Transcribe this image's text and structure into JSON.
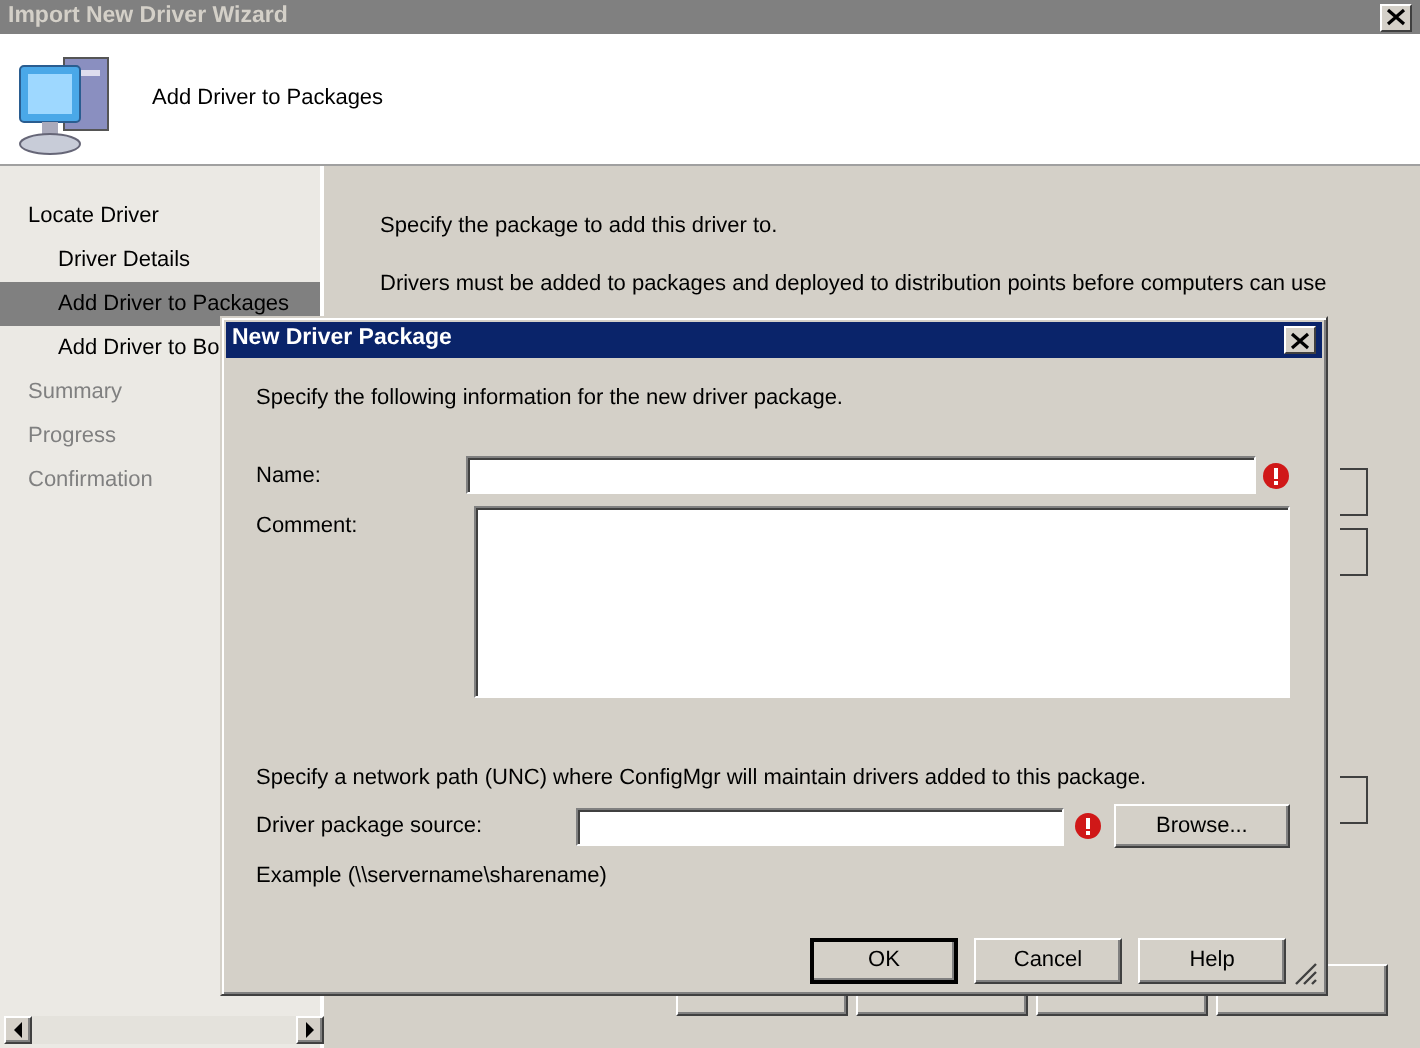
{
  "wizard": {
    "title": "Import New Driver Wizard",
    "header": "Add Driver to Packages",
    "steps": [
      {
        "label": "Locate Driver",
        "selected": false,
        "disabled": false,
        "children": [
          {
            "label": "Driver Details",
            "selected": false,
            "disabled": false
          },
          {
            "label": "Add Driver to Packages",
            "selected": true,
            "disabled": false
          },
          {
            "label": "Add Driver to Bo",
            "selected": false,
            "disabled": false
          }
        ]
      },
      {
        "label": "Summary",
        "selected": false,
        "disabled": true
      },
      {
        "label": "Progress",
        "selected": false,
        "disabled": true
      },
      {
        "label": "Confirmation",
        "selected": false,
        "disabled": true
      }
    ],
    "content": {
      "instruction": "Specify the package to add this driver to.",
      "note_lines": [
        "Drivers must be added to packages and deployed to distribution points before computers can use"
      ]
    }
  },
  "dialog": {
    "title": "New Driver Package",
    "intro": "Specify the following information for the new driver package.",
    "fields": [
      {
        "label": "Name:",
        "kind": "text",
        "required": true
      },
      {
        "label": "Comment:",
        "kind": "textarea",
        "required": false
      }
    ],
    "unc_hint": "Specify a network path (UNC) where ConfigMgr will maintain drivers added to this package.",
    "source": {
      "label": "Driver package source:",
      "required": true,
      "button": "Browse..."
    },
    "example": "Example (\\\\servername\\sharename)",
    "buttons": [
      {
        "label": "OK",
        "default": true
      },
      {
        "label": "Cancel",
        "default": false
      },
      {
        "label": "Help",
        "default": false
      }
    ]
  }
}
